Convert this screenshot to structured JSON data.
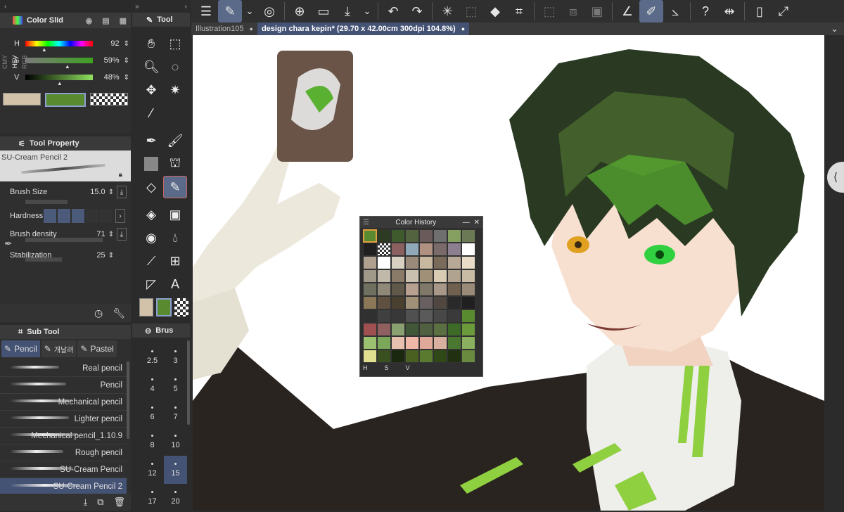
{
  "color_panel": {
    "title": "Color Slid",
    "modes": [
      "RGB",
      "HSV",
      "CMY"
    ],
    "sliders": [
      {
        "label": "H",
        "value": "92"
      },
      {
        "label": "S",
        "value": "59%"
      },
      {
        "label": "V",
        "value": "48%"
      }
    ],
    "colors": {
      "main": "#d2c2aa",
      "sub": "#5a8a30"
    }
  },
  "tool_property": {
    "title": "Tool Property",
    "brush_name": "SU-Cream Pencil 2",
    "rows": [
      {
        "label": "Brush Size",
        "value": "15.0"
      },
      {
        "label": "Hardness",
        "value": ""
      },
      {
        "label": "Brush density",
        "value": "71"
      },
      {
        "label": "Stabilization",
        "value": "25"
      }
    ]
  },
  "sub_tool": {
    "title": "Sub Tool",
    "tabs": [
      "Pencil",
      "개날려",
      "Pastel"
    ],
    "brushes": [
      "Real pencil",
      "Pencil",
      "Mechanical pencil",
      "Lighter pencil",
      "Mechanical pencil_1.10.9",
      "Rough pencil",
      "SU-Cream Pencil",
      "SU-Cream Pencil 2"
    ],
    "selected_index": 7
  },
  "tool_panel": {
    "title": "Tool"
  },
  "brush_size_panel": {
    "title": "Brus",
    "sizes": [
      "2.5",
      "3",
      "4",
      "5",
      "6",
      "7",
      "8",
      "10",
      "12",
      "15",
      "17",
      "20"
    ],
    "selected": "15"
  },
  "tabs": {
    "inactive": "Illustration105",
    "active": "design chara kepin* (29.70 x 42.00cm 300dpi 104.8%)"
  },
  "color_history": {
    "title": "Color History",
    "footer": [
      "H",
      "S",
      "V"
    ],
    "colors": [
      "#5a8a30",
      "#2c3b22",
      "#3f5a2d",
      "#53633f",
      "#6a5a5a",
      "#6f6f6f",
      "#85a060",
      "#6b7a55",
      "#202020",
      "#ffffff",
      "#8a6060",
      "#90a8b8",
      "#b09080",
      "#7a6a6a",
      "#8c8090",
      "#ffffff",
      "#b0a090",
      "#ffffff",
      "#d8d0c0",
      "#9a8a7a",
      "#c8b8a0",
      "#7a6a5a",
      "#b8a898",
      "#e8dcc8",
      "#a09888",
      "#c0b8a8",
      "#8a7a68",
      "#cac0b0",
      "#a09078",
      "#d8ccb4",
      "#b0a490",
      "#c8bca4",
      "#707060",
      "#908878",
      "#605848",
      "#b8a090",
      "#807868",
      "#a89888",
      "#706050",
      "#9a8a78",
      "#8a7858",
      "#605040",
      "#4a4030",
      "#a09078",
      "#686060",
      "#504840",
      "#2a2a2a",
      "#202020",
      "#303030",
      "#404040",
      "#383838",
      "#505050",
      "#5a5a5a",
      "#484848",
      "#3a3a3a",
      "#5a8a30",
      "#a05050",
      "#906060",
      "#8aa070",
      "#405838",
      "#506040",
      "#5a7040",
      "#3e6a28",
      "#6a9a3a",
      "#9ac070",
      "#7aa858",
      "#e8c0b0",
      "#f0b8a8",
      "#e0a898",
      "#d8b0a0",
      "#4a7830",
      "#8ab060",
      "#e0e090",
      "#3a5020",
      "#1a2810",
      "#4a6020",
      "#5a7a30",
      "#304818",
      "#203010",
      "#6a8a40"
    ]
  }
}
